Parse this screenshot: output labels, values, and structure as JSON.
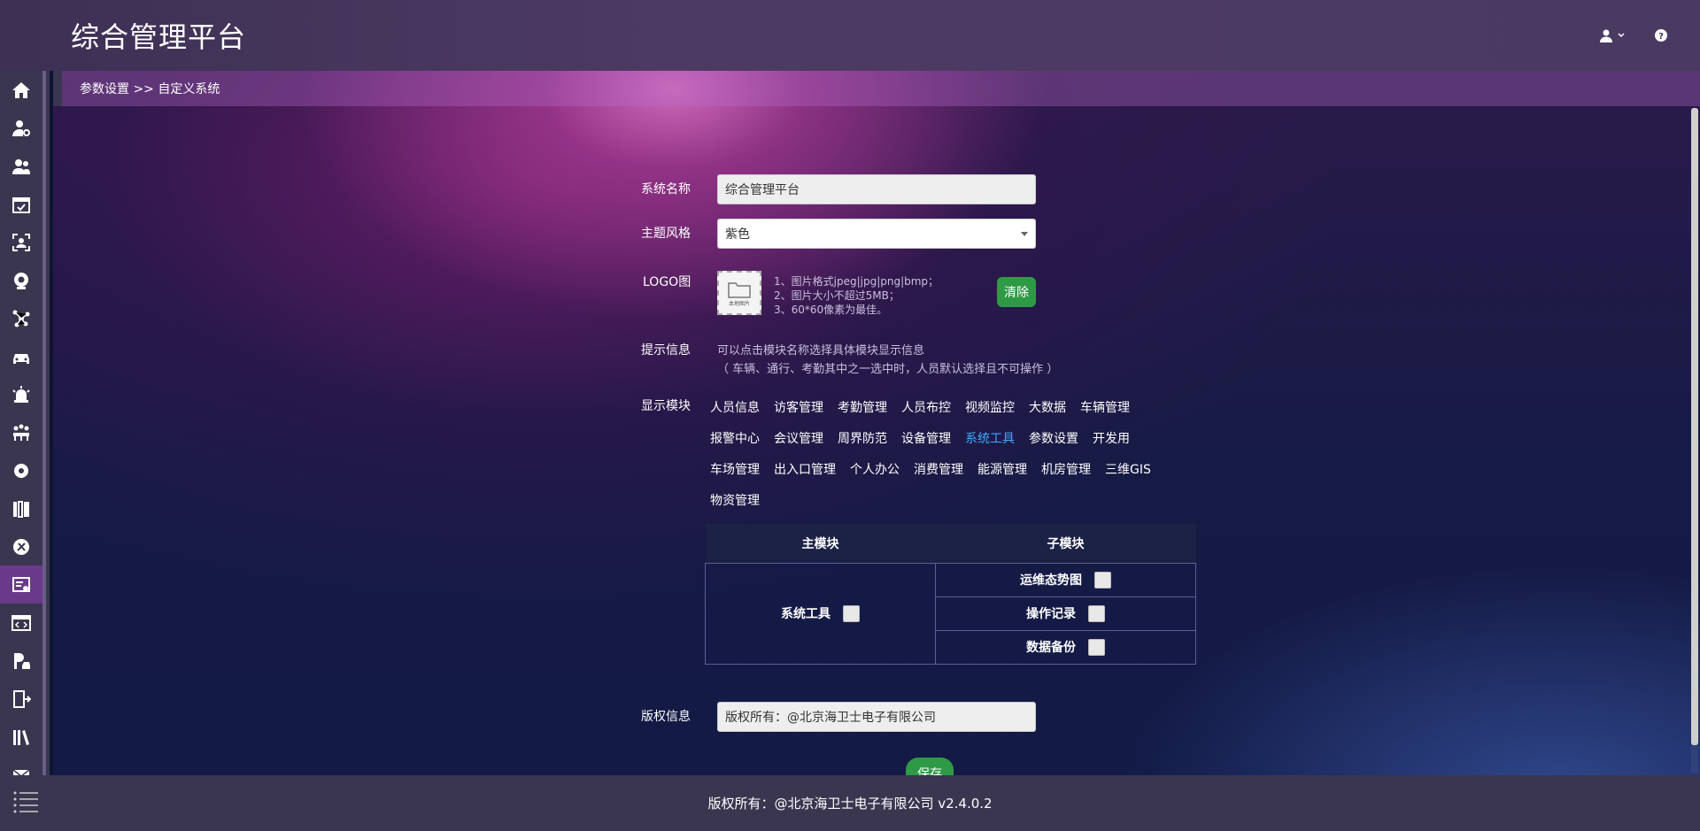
{
  "header": {
    "app_title": "综合管理平台",
    "icons": [
      "user-icon",
      "chevron-down-icon",
      "help-icon"
    ]
  },
  "sidebar": {
    "items": [
      {
        "icon": "home-icon"
      },
      {
        "icon": "user-settings-icon"
      },
      {
        "icon": "visitor-icon"
      },
      {
        "icon": "calendar-check-icon"
      },
      {
        "icon": "face-scan-icon"
      },
      {
        "icon": "camera-icon"
      },
      {
        "icon": "network-icon"
      },
      {
        "icon": "car-icon"
      },
      {
        "icon": "alarm-icon"
      },
      {
        "icon": "meeting-icon"
      },
      {
        "icon": "shield-gear-icon"
      },
      {
        "icon": "device-rack-icon"
      },
      {
        "icon": "tools-icon"
      },
      {
        "icon": "settings-panel-icon",
        "active": true
      },
      {
        "icon": "code-window-icon"
      },
      {
        "icon": "parking-icon"
      },
      {
        "icon": "door-exit-icon"
      },
      {
        "icon": "books-icon"
      },
      {
        "icon": "mail-icon"
      }
    ],
    "accent": "#6a3a8a"
  },
  "breadcrumb": "参数设置 >> 自定义系统",
  "form": {
    "system_name": {
      "label": "系统名称",
      "value": "综合管理平台"
    },
    "theme": {
      "label": "主题风格",
      "value": "紫色"
    },
    "logo": {
      "label": "LOGO图",
      "placeholder_text": "本地图片",
      "tips": [
        "1、图片格式jpeg|jpg|png|bmp；",
        "2、图片大小不超过5MB；",
        "3、60*60像素为最佳。"
      ],
      "clear_label": "清除"
    },
    "hint": {
      "label": "提示信息",
      "line1": "可以点击模块名称选择具体模块显示信息",
      "line2": "（ 车辆、通行、考勤其中之一选中时，人员默认选择且不可操作 ）"
    },
    "modules": {
      "label": "显示模块",
      "rows": [
        [
          "人员信息",
          "访客管理",
          "考勤管理",
          "人员布控",
          "视频监控",
          "大数据",
          "车辆管理"
        ],
        [
          "报警中心",
          "会议管理",
          "周界防范",
          "设备管理",
          "系统工具",
          "参数设置",
          "开发用"
        ],
        [
          "车场管理",
          "出入口管理",
          "个人办公",
          "消费管理",
          "能源管理",
          "机房管理",
          "三维GIS"
        ],
        [
          "物资管理"
        ]
      ],
      "selected": "系统工具",
      "selected_color": "#3fa8ff"
    },
    "table": {
      "headers": [
        "主模块",
        "子模块"
      ],
      "main_module": "系统工具",
      "sub_modules": [
        "运维态势图",
        "操作记录",
        "数据备份"
      ]
    },
    "copyright": {
      "label": "版权信息",
      "value": "版权所有：@北京海卫士电子有限公司"
    },
    "save_label": "保存"
  },
  "footer": {
    "text": "版权所有：@北京海卫士电子有限公司 v2.4.0.2"
  }
}
